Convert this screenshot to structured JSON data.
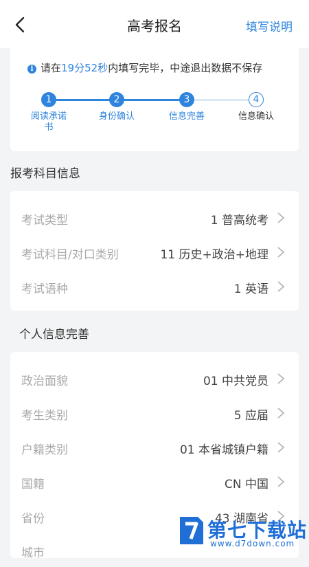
{
  "header": {
    "title": "高考报名",
    "help_label": "填写说明"
  },
  "notice": {
    "prefix": "请在",
    "time": "19分52秒",
    "suffix": "内填写完毕，中途退出数据不保存"
  },
  "steps": [
    {
      "number": "1",
      "label": "阅读承诺书",
      "state": "done"
    },
    {
      "number": "2",
      "label": "身份确认",
      "state": "done"
    },
    {
      "number": "3",
      "label": "信息完善",
      "state": "done"
    },
    {
      "number": "4",
      "label": "信息确认",
      "state": "todo"
    }
  ],
  "subjects_section": {
    "title": "报考科目信息",
    "rows": [
      {
        "label": "考试类型",
        "value": "1 普高统考"
      },
      {
        "label": "考试科目/对口类别",
        "value": "11 历史+政治+地理"
      },
      {
        "label": "考试语种",
        "value": "1 英语"
      }
    ]
  },
  "personal_section": {
    "title": "个人信息完善",
    "rows": [
      {
        "label": "政治面貌",
        "value": "01 中共党员"
      },
      {
        "label": "考生类别",
        "value": "5 应届"
      },
      {
        "label": "户籍类别",
        "value": "01 本省城镇户籍"
      },
      {
        "label": "国籍",
        "value": "CN 中国"
      },
      {
        "label": "省份",
        "value": "43 湖南省"
      },
      {
        "label": "城市",
        "value": ""
      }
    ]
  },
  "watermark": {
    "title": "第七下载站",
    "url": "www.d7down.com"
  },
  "colors": {
    "accent": "#2f84dd",
    "label_gray": "#aaaaaa",
    "background": "#f3f4f6"
  }
}
